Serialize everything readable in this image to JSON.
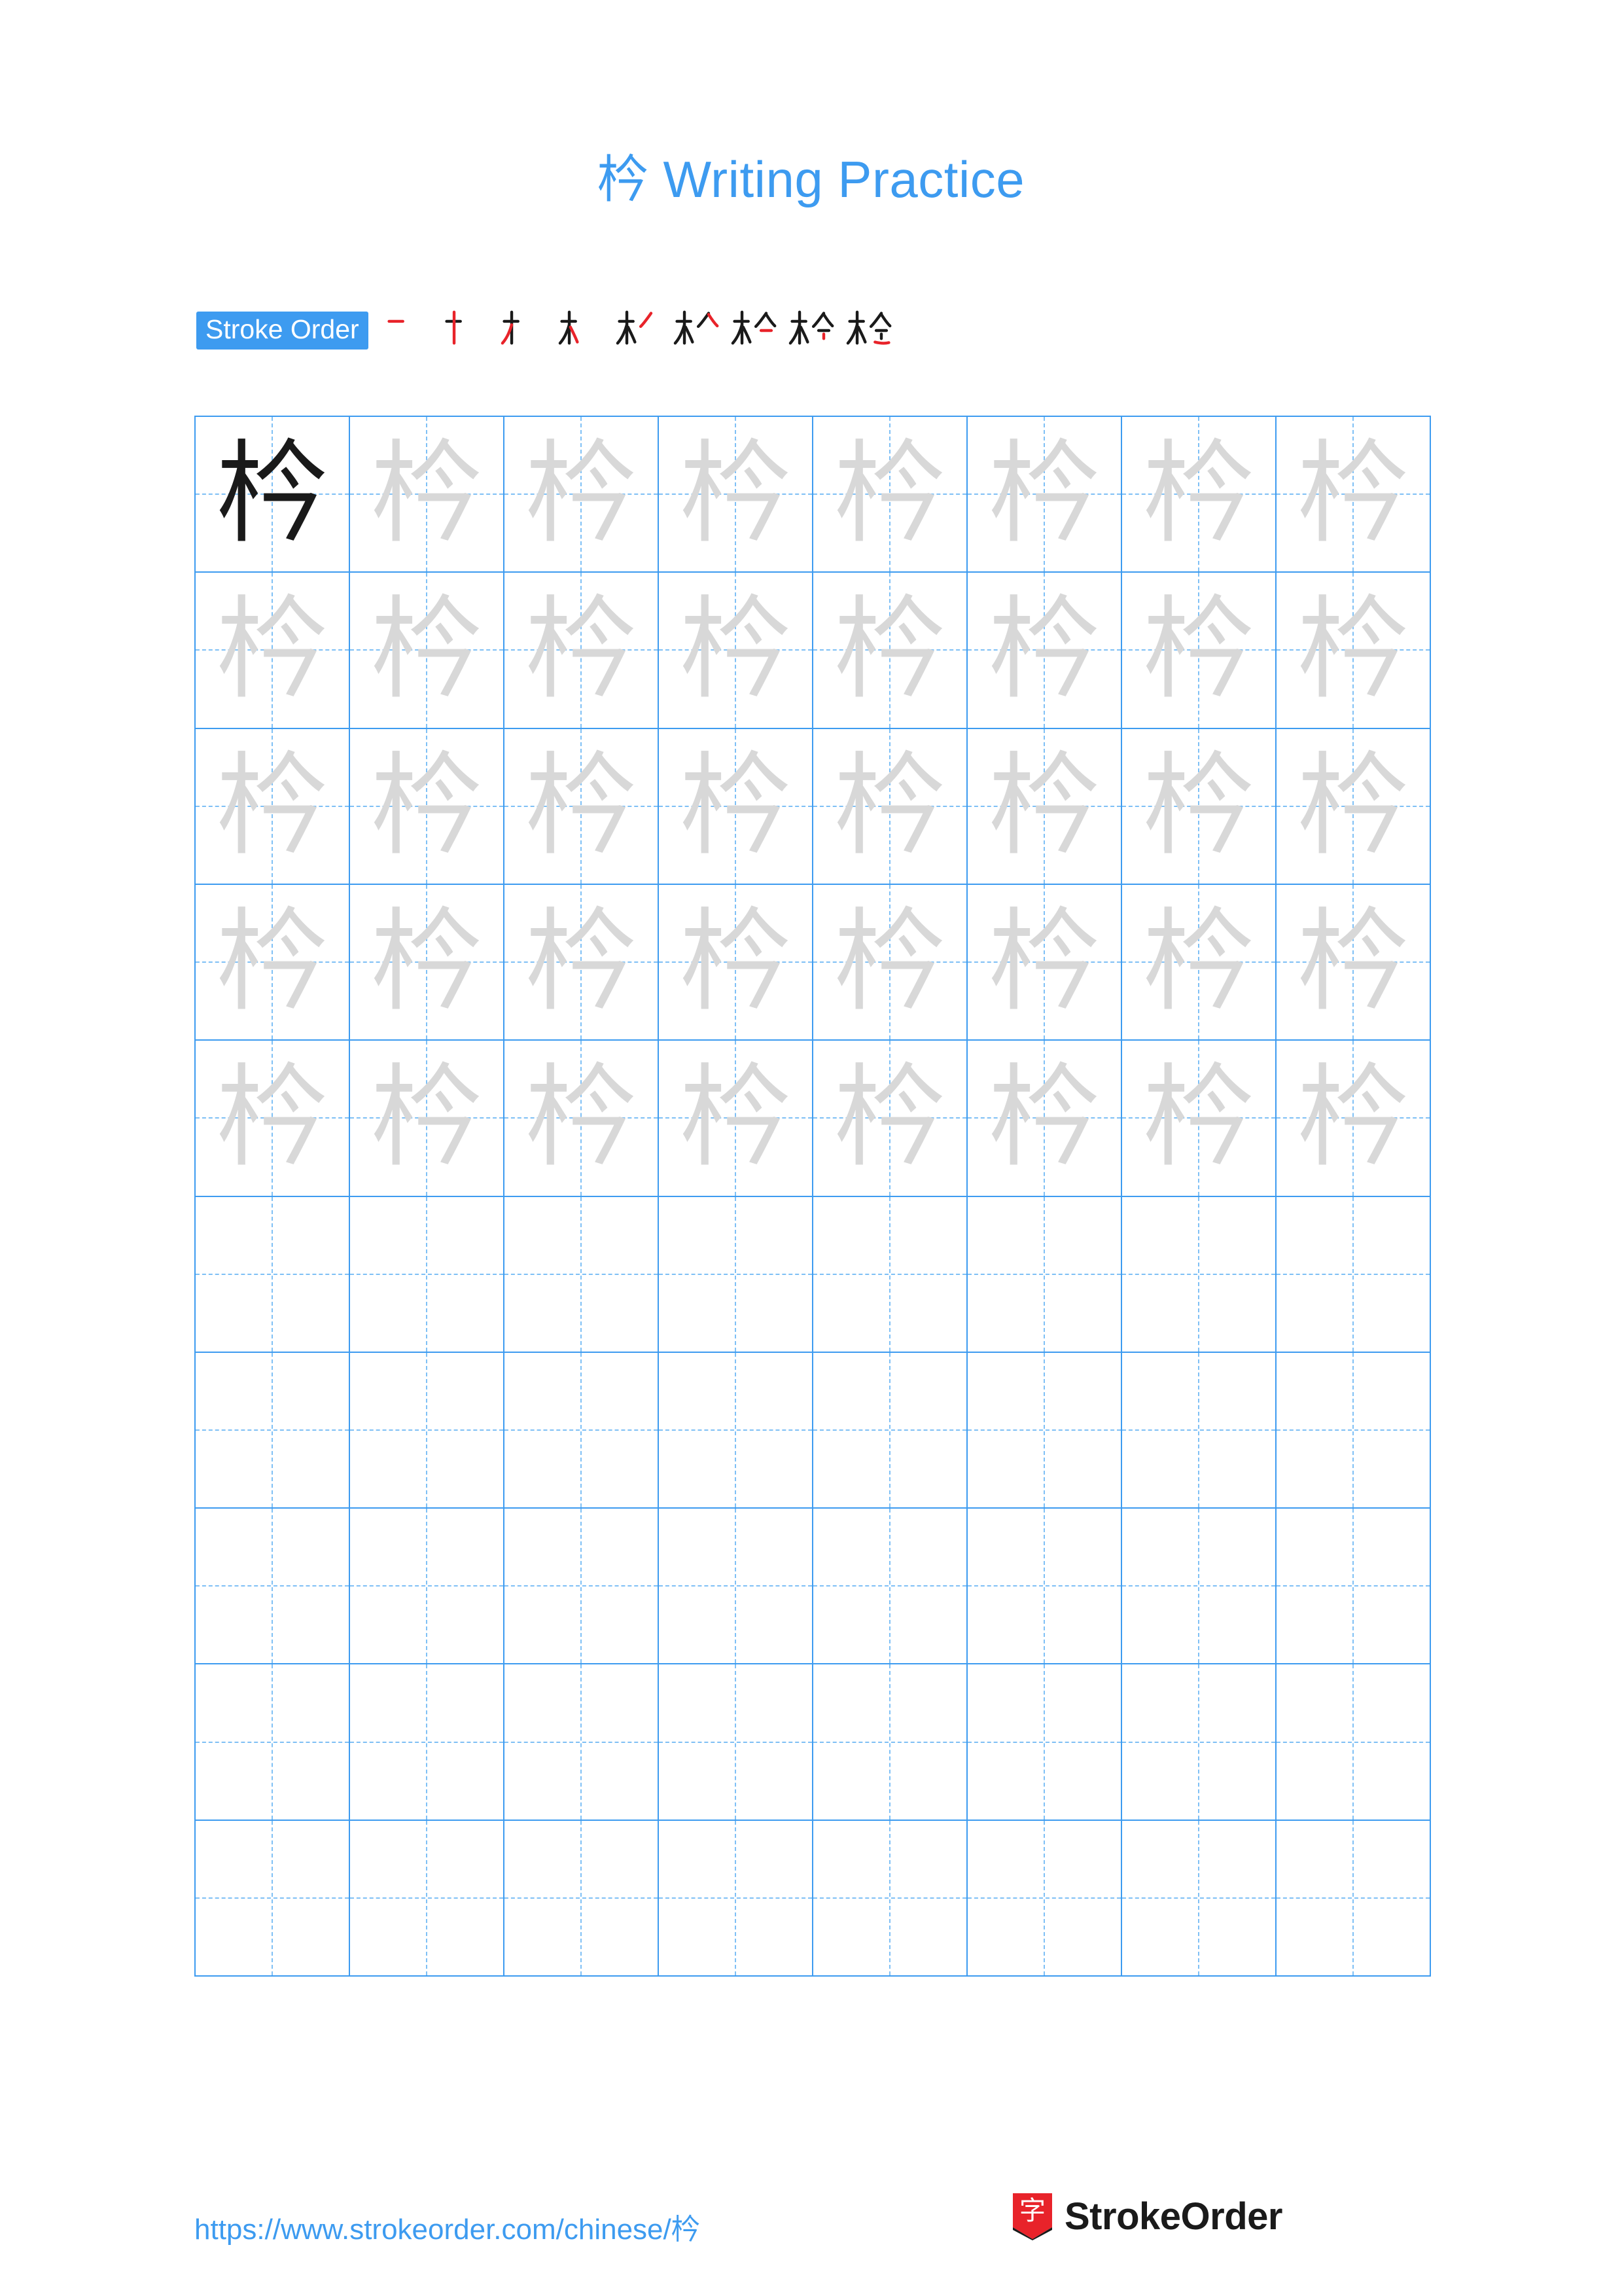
{
  "document": {
    "character": "枔",
    "title": "枔 Writing Practice",
    "title_accent_color": "#3d9bf0"
  },
  "stroke_order": {
    "label": "Stroke Order",
    "badge_bg": "#3d9bf0",
    "badge_text_color": "#ffffff",
    "new_stroke_color": "#e8232a",
    "old_stroke_color": "#1a1a1a",
    "stroke_count": 9,
    "steps": [
      {
        "index": 1,
        "partial": "一"
      },
      {
        "index": 2,
        "partial": "十"
      },
      {
        "index": 3,
        "partial": "才"
      },
      {
        "index": 4,
        "partial": "木"
      },
      {
        "index": 5,
        "partial": "朩"
      },
      {
        "index": 6,
        "partial": "朴"
      },
      {
        "index": 7,
        "partial": "杁"
      },
      {
        "index": 8,
        "partial": "枔"
      },
      {
        "index": 9,
        "partial": "枔"
      }
    ]
  },
  "grid": {
    "columns": 8,
    "rows": 10,
    "border_color": "#3d9bf0",
    "guide_color": "#7fc0f5",
    "dark_glyph_color": "#1a1a1a",
    "traced_glyph_color": "#d8d8d8",
    "cells": [
      [
        "dark",
        "light",
        "light",
        "light",
        "light",
        "light",
        "light",
        "light"
      ],
      [
        "light",
        "light",
        "light",
        "light",
        "light",
        "light",
        "light",
        "light"
      ],
      [
        "light",
        "light",
        "light",
        "light",
        "light",
        "light",
        "light",
        "light"
      ],
      [
        "light",
        "light",
        "light",
        "light",
        "light",
        "light",
        "light",
        "light"
      ],
      [
        "light",
        "light",
        "light",
        "light",
        "light",
        "light",
        "light",
        "light"
      ],
      [
        "blank",
        "blank",
        "blank",
        "blank",
        "blank",
        "blank",
        "blank",
        "blank"
      ],
      [
        "blank",
        "blank",
        "blank",
        "blank",
        "blank",
        "blank",
        "blank",
        "blank"
      ],
      [
        "blank",
        "blank",
        "blank",
        "blank",
        "blank",
        "blank",
        "blank",
        "blank"
      ],
      [
        "blank",
        "blank",
        "blank",
        "blank",
        "blank",
        "blank",
        "blank",
        "blank"
      ],
      [
        "blank",
        "blank",
        "blank",
        "blank",
        "blank",
        "blank",
        "blank",
        "blank"
      ]
    ]
  },
  "footer": {
    "url": "https://www.strokeorder.com/chinese/枔",
    "url_color": "#3d9bf0",
    "brand_name": "StrokeOrder",
    "logo_character": "字",
    "logo_color": "#e8232a"
  }
}
